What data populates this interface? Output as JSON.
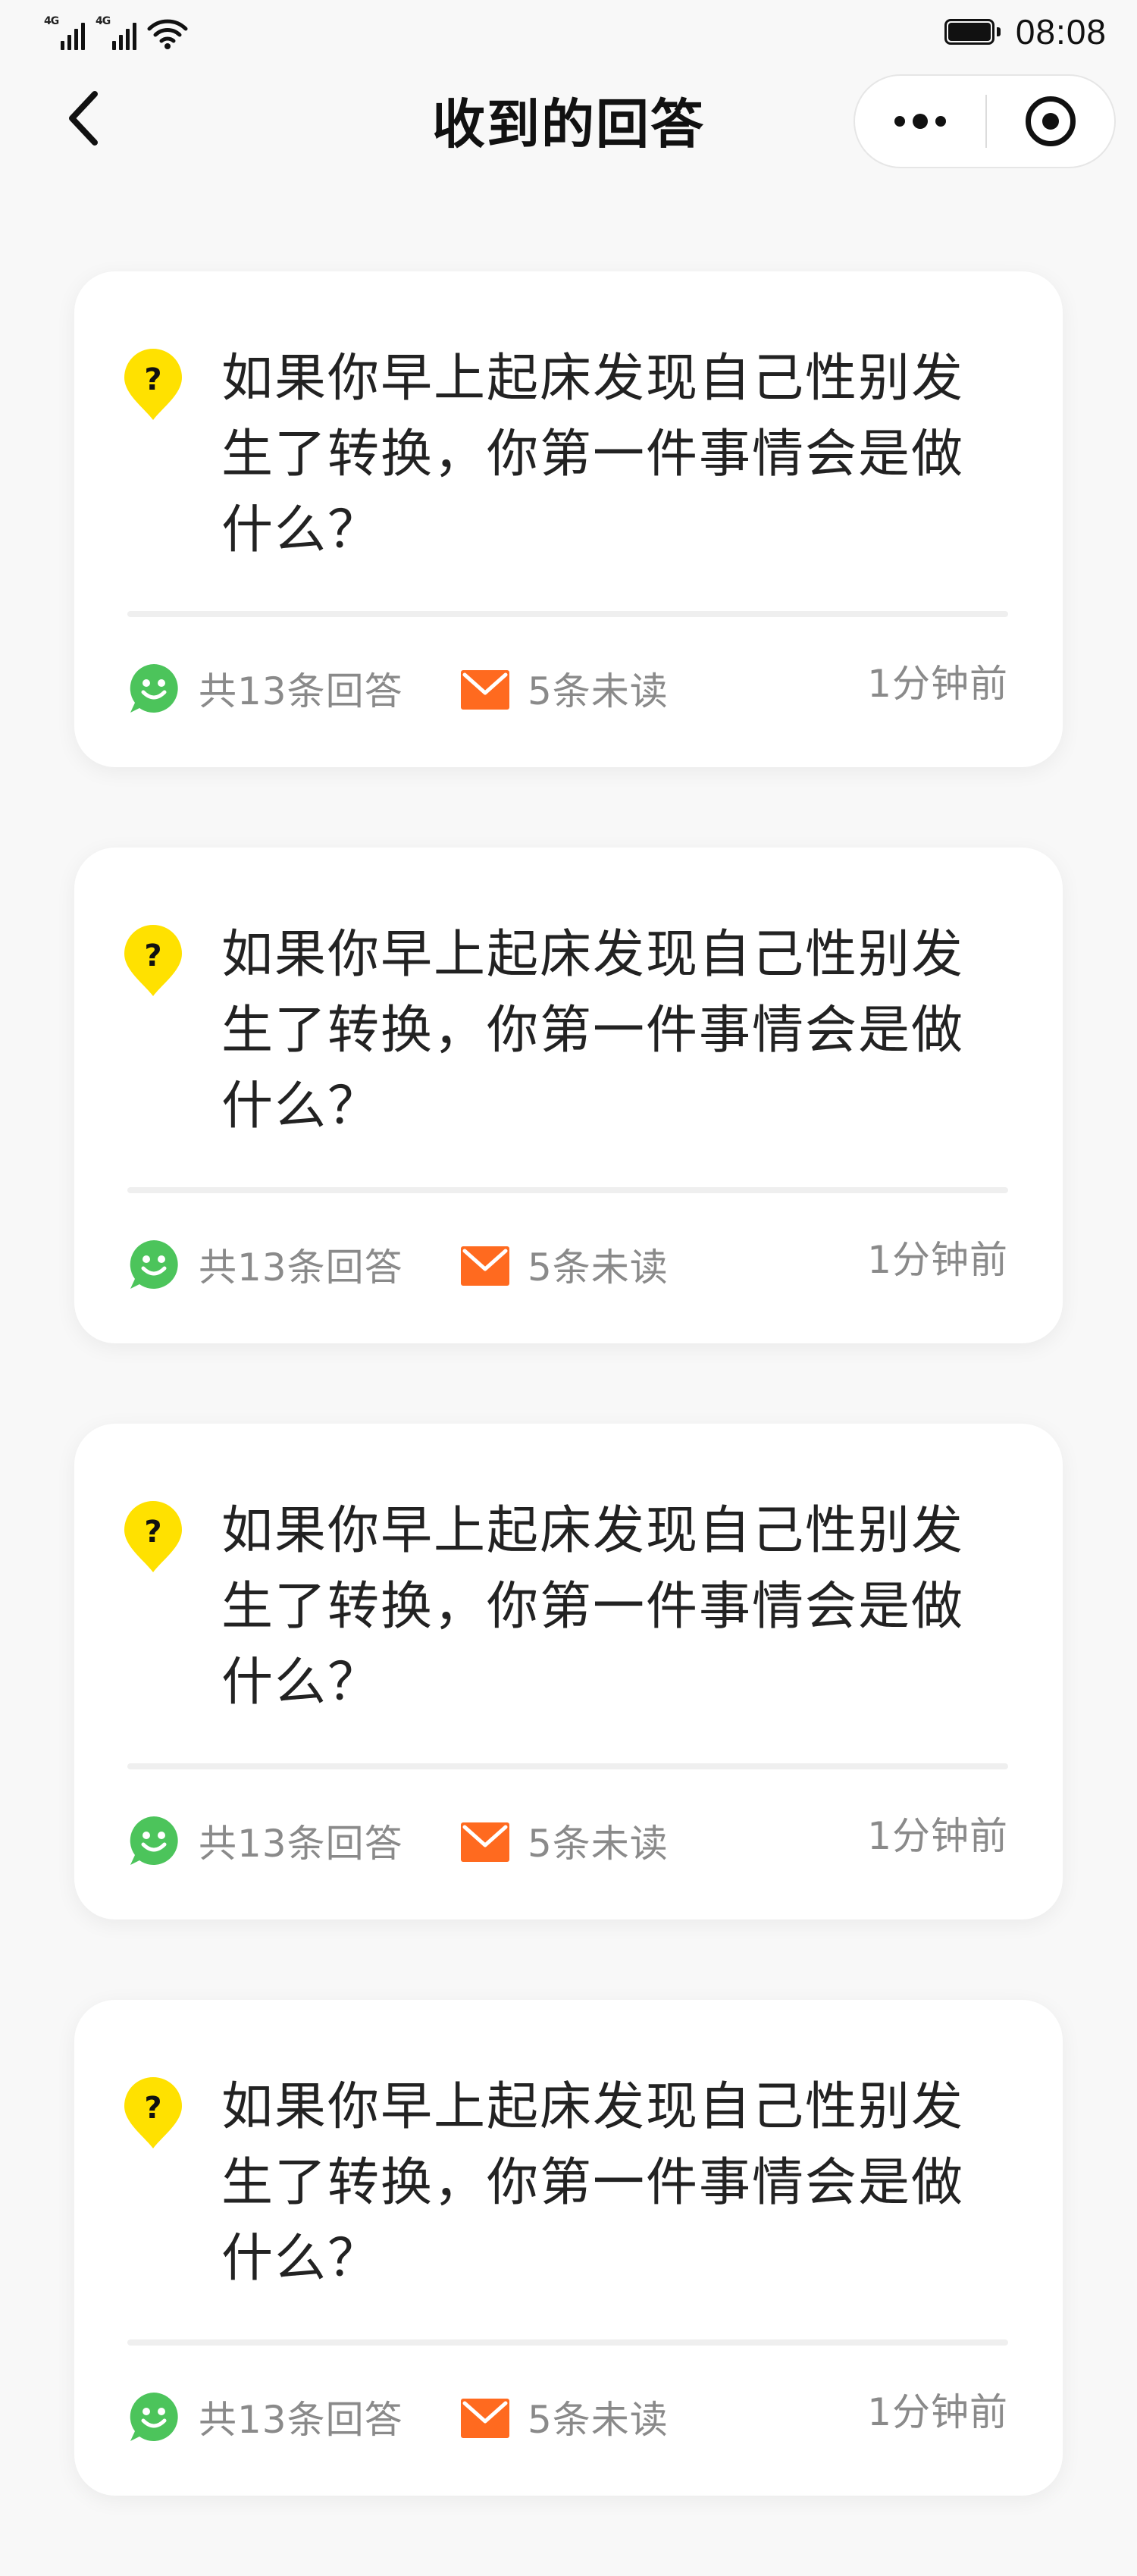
{
  "status_bar": {
    "network_1": "4G",
    "network_2": "4G",
    "time": "08:08",
    "battery_level": 1.0
  },
  "nav": {
    "title": "收到的回答",
    "back_icon": "chevron-left-icon",
    "more_icon": "more-dots-icon",
    "close_icon": "target-circle-icon"
  },
  "colors": {
    "question_icon": "#FFE100",
    "answers_icon": "#4CC45B",
    "unread_icon": "#FF6A1F",
    "meta_text": "#8A8A8A"
  },
  "cards": [
    {
      "question": "如果你早上起床发现自己性别发生了转换，你第一件事情会是做什么？",
      "answers": "共13条回答",
      "unread": "5条未读",
      "time_ago": "1分钟前"
    },
    {
      "question": "如果你早上起床发现自己性别发生了转换，你第一件事情会是做什么？",
      "answers": "共13条回答",
      "unread": "5条未读",
      "time_ago": "1分钟前"
    },
    {
      "question": "如果你早上起床发现自己性别发生了转换，你第一件事情会是做什么？",
      "answers": "共13条回答",
      "unread": "5条未读",
      "time_ago": "1分钟前"
    },
    {
      "question": "如果你早上起床发现自己性别发生了转换，你第一件事情会是做什么？",
      "answers": "共13条回答",
      "unread": "5条未读",
      "time_ago": "1分钟前"
    }
  ]
}
